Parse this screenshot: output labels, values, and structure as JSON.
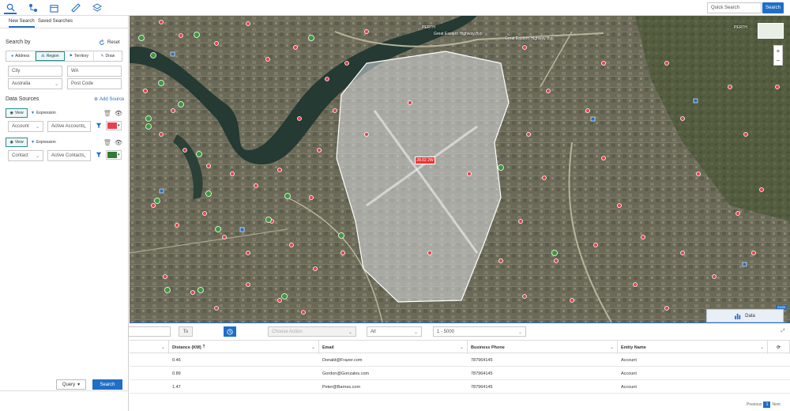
{
  "topbar": {
    "quick_search_placeholder": "Quick Search",
    "search_label": "Search"
  },
  "tabs": [
    "New Search",
    "Saved Searches"
  ],
  "search_by": {
    "title": "Search by",
    "reset_label": "Reset",
    "modes": [
      "Address",
      "Region",
      "Territory",
      "Draw"
    ],
    "city_placeholder": "City",
    "state_value": "WA",
    "country_value": "Australia",
    "postcode_placeholder": "Post Code"
  },
  "data_sources": {
    "title": "Data Sources",
    "add_source_label": "Add Source",
    "sources": [
      {
        "view_label": "View",
        "expression_label": "Expression",
        "entity": "Account",
        "view": "Active Accounts",
        "color": "#e8404a"
      },
      {
        "view_label": "View",
        "expression_label": "Expression",
        "entity": "Contact",
        "view": "Active Contacts",
        "color": "#2e7d32"
      }
    ]
  },
  "footer": {
    "query_label": "Query",
    "search_label": "Search"
  },
  "map": {
    "labels": {
      "perth_top": "PERTH",
      "perth_right": "PERTH",
      "great_eastern_1": "Great Eastern Highway Byp",
      "great_eastern_2": "Great Eastern Highway Byp",
      "price_tag": "28.02 2W",
      "scale": "23/30"
    },
    "data_button_label": "Data",
    "accent_color": "#1e6fc6"
  },
  "grid_toolbar": {
    "to_label": "To",
    "action_placeholder": "Choose Action",
    "filter_value": "All",
    "range_value": "1 - 5000"
  },
  "grid": {
    "columns": [
      "Distance (KM)",
      "Email",
      "Business Phone",
      "Entity Name"
    ],
    "rows": [
      [
        "0.46",
        "Donald@Frazer.com",
        "787964145",
        "Account"
      ],
      [
        "0.89",
        "Gordon@Gonzales.com",
        "787964145",
        "Account"
      ],
      [
        "1.47",
        "Peter@Barnes.com",
        "787964145",
        "Account"
      ]
    ]
  },
  "pager": {
    "previous_label": "Previous",
    "current_page": "1",
    "next_label": "Next"
  }
}
